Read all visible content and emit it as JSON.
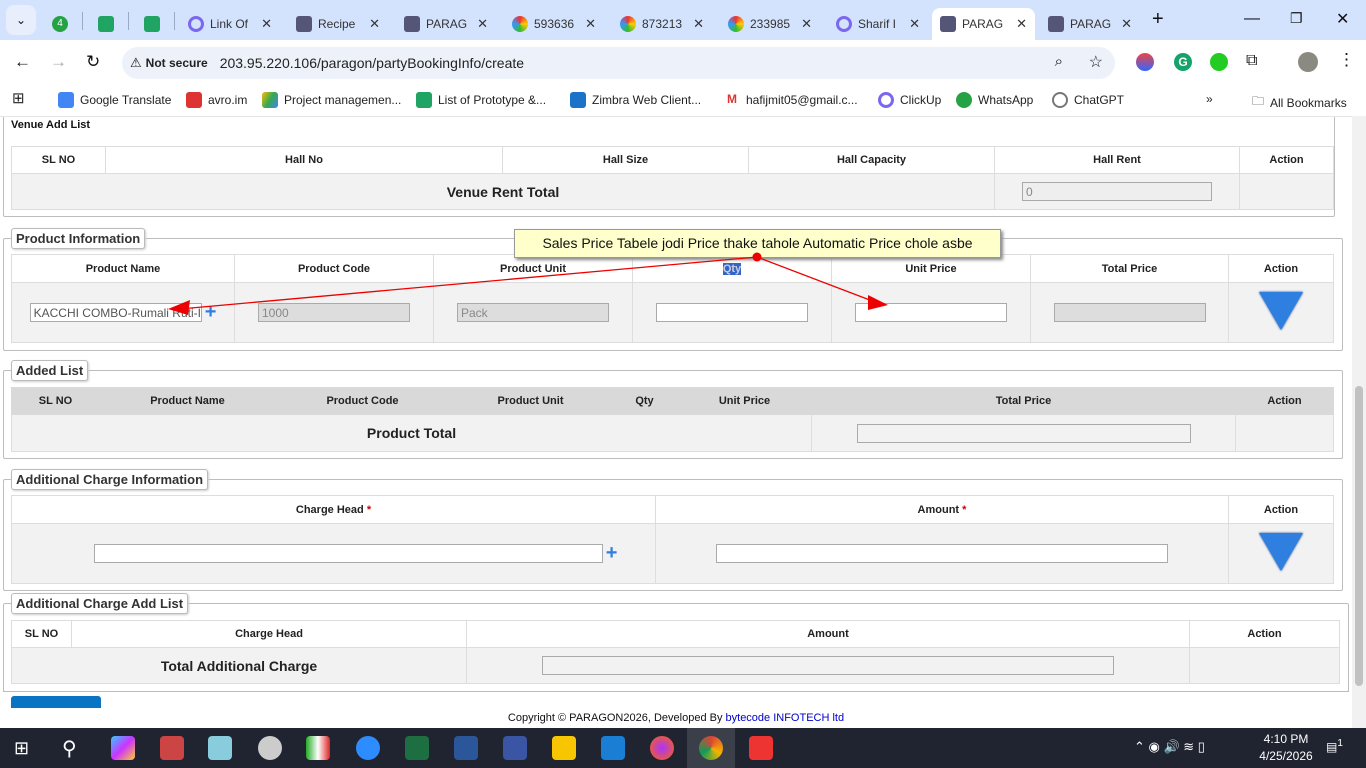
{
  "browser": {
    "tabs": [
      {
        "label": "4",
        "icon": "whatsapp-icon"
      },
      {
        "label": "",
        "icon": "sheets-icon"
      },
      {
        "label": "",
        "icon": "sheets-icon"
      },
      {
        "label": "Link Of",
        "icon": "clickup-icon"
      },
      {
        "label": "Recipe",
        "icon": "paragon-icon"
      },
      {
        "label": "PARAG",
        "icon": "paragon-icon"
      },
      {
        "label": "593636",
        "icon": "photos-icon"
      },
      {
        "label": "873213",
        "icon": "photos-icon"
      },
      {
        "label": "233985",
        "icon": "photos-icon"
      },
      {
        "label": "Sharif I",
        "icon": "clickup-icon"
      },
      {
        "label": "PARAG",
        "icon": "paragon-icon",
        "active": true
      },
      {
        "label": "PARAG",
        "icon": "paragon-icon"
      }
    ],
    "not_secure": "Not secure",
    "url": "203.95.220.106/paragon/partyBookingInfo/create",
    "bookmarks": [
      "Google Translate",
      "avro.im",
      "Project managemen...",
      "List of Prototype &...",
      "Zimbra Web Client...",
      "hafijmit05@gmail.c...",
      "ClickUp",
      "WhatsApp",
      "ChatGPT"
    ],
    "all_bookmarks": "All Bookmarks"
  },
  "venue": {
    "title": "Venue Add List",
    "headers": [
      "SL NO",
      "Hall No",
      "Hall Size",
      "Hall Capacity",
      "Hall Rent",
      "Action"
    ],
    "total_label": "Venue Rent Total",
    "total_value": "0"
  },
  "product": {
    "legend": "Product Information",
    "headers": [
      "Product Name",
      "Product Code",
      "Product Unit",
      "Qty",
      "Unit Price",
      "Total Price",
      "Action"
    ],
    "name_value": "KACCHI COMBO-Rumali Ruti-I",
    "code_value": "1000",
    "unit_value": "Pack",
    "qty_value": "",
    "unit_price_value": "",
    "total_price_value": ""
  },
  "added": {
    "legend": "Added List",
    "headers": [
      "SL NO",
      "Product Name",
      "Product Code",
      "Product Unit",
      "Qty",
      "Unit Price",
      "Total Price",
      "Action"
    ],
    "total_label": "Product Total"
  },
  "charge": {
    "legend": "Additional Charge Information",
    "headers": [
      "Charge Head",
      "Amount",
      "Action"
    ],
    "required": "*"
  },
  "charge_list": {
    "legend": "Additional Charge Add List",
    "headers": [
      "SL NO",
      "Charge Head",
      "Amount",
      "Action"
    ],
    "total_label": "Total Additional Charge"
  },
  "annotation": "Sales Price Tabele jodi Price thake tahole Automatic Price chole asbe",
  "footer": {
    "text": "Copyright © PARAGON2026, Developed By ",
    "link": "bytecode INFOTECH ltd"
  },
  "taskbar": {
    "time": "4:10 PM",
    "date": "4/25/2026",
    "notifications": "1"
  }
}
